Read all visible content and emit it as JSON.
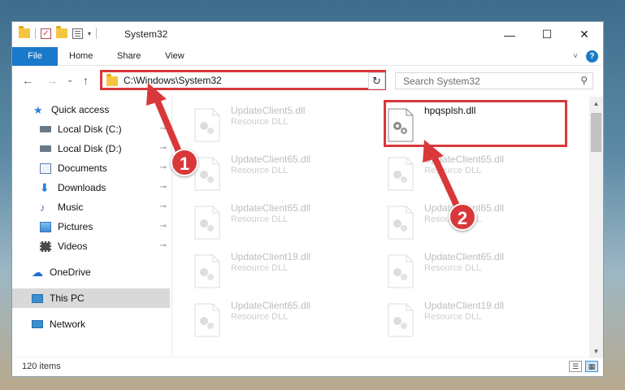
{
  "window": {
    "title": "System32"
  },
  "win_buttons": {
    "minimize": "—",
    "maximize": "☐",
    "close": "✕"
  },
  "ribbon": {
    "tabs": [
      "File",
      "Home",
      "Share",
      "View"
    ],
    "expand_icon": "˅",
    "help_icon": "?"
  },
  "address": {
    "path": "C:\\Windows\\System32",
    "dropdown": "⌵",
    "refresh": "↻"
  },
  "search": {
    "placeholder": "Search System32",
    "icon": "⚲"
  },
  "nav": {
    "back": "←",
    "forward": "→",
    "recent": "⌄",
    "up": "↑",
    "items": [
      {
        "label": "Quick access",
        "icon": "star-icon",
        "color": "#2a7fd4"
      },
      {
        "label": "Local Disk (C:)",
        "icon": "drive-icon",
        "color": "#6b7a88"
      },
      {
        "label": "Local Disk (D:)",
        "icon": "drive-icon",
        "color": "#6b7a88"
      },
      {
        "label": "Documents",
        "icon": "documents-icon",
        "color": "#5f7fa8"
      },
      {
        "label": "Downloads",
        "icon": "downloads-icon",
        "color": "#2a7fd4"
      },
      {
        "label": "Music",
        "icon": "music-icon",
        "color": "#3a74c4"
      },
      {
        "label": "Pictures",
        "icon": "pictures-icon",
        "color": "#3a8fd0"
      },
      {
        "label": "Videos",
        "icon": "videos-icon",
        "color": "#4a4a4a"
      },
      {
        "label": "OneDrive",
        "icon": "cloud-icon",
        "color": "#1e6fd1"
      },
      {
        "label": "This PC",
        "icon": "pc-icon",
        "color": "#3a8fd0"
      },
      {
        "label": "Network",
        "icon": "network-icon",
        "color": "#3a8fd0"
      }
    ],
    "pin": "⊸"
  },
  "files": [
    {
      "name": "UpdateClient5.dll",
      "desc": "Resource DLL"
    },
    {
      "name": "hpqsplsh.dll",
      "desc": ""
    },
    {
      "name": "UpdateClient65.dll",
      "desc": "Resource DLL"
    },
    {
      "name": "UpdateClient65.dll",
      "desc": "Resource DLL"
    },
    {
      "name": "UpdateClient65.dll",
      "desc": "Resource DLL"
    },
    {
      "name": "UpdateClient65.dll",
      "desc": "Resource DLL"
    },
    {
      "name": "UpdateClient19.dll",
      "desc": "Resource DLL"
    },
    {
      "name": "UpdateClient65.dll",
      "desc": "Resource DLL"
    },
    {
      "name": "UpdateClient65.dll",
      "desc": "Resource DLL"
    },
    {
      "name": "UpdateClient19.dll",
      "desc": "Resource DLL"
    }
  ],
  "status": {
    "items": "120 items"
  },
  "callouts": {
    "one": "1",
    "two": "2"
  },
  "colors": {
    "accent": "#1979ca",
    "highlight": "#d9383a"
  }
}
